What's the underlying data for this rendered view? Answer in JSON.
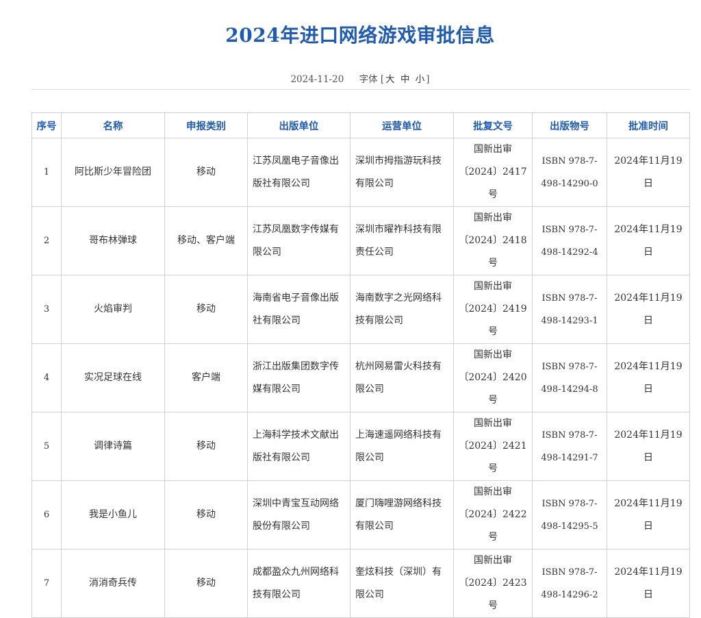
{
  "page": {
    "title": "2024年进口网络游戏审批信息",
    "date": "2024-11-20",
    "font_size_label": "字体",
    "font_size_open": "[",
    "font_size_large": "大",
    "font_size_medium": "中",
    "font_size_small": "小",
    "font_size_close": "]"
  },
  "table": {
    "headers": [
      "序号",
      "名称",
      "申报类别",
      "出版单位",
      "运营单位",
      "批复文号",
      "出版物号",
      "批准时间"
    ],
    "rows": [
      {
        "no": "1",
        "name": "阿比斯少年冒险团",
        "category": "移动",
        "publisher": "江苏凤凰电子音像出版社有限公司",
        "operator": "深圳市拇指游玩科技有限公司",
        "approval_no": "国新出审〔2024〕2417号",
        "isbn": "ISBN 978-7-498-14290-0",
        "date": "2024年11月19日"
      },
      {
        "no": "2",
        "name": "哥布林弹球",
        "category": "移动、客户端",
        "publisher": "江苏凤凰数字传媒有限公司",
        "operator": "深圳市曜祚科技有限责任公司",
        "approval_no": "国新出审〔2024〕2418号",
        "isbn": "ISBN 978-7-498-14292-4",
        "date": "2024年11月19日"
      },
      {
        "no": "3",
        "name": "火焰审判",
        "category": "移动",
        "publisher": "海南省电子音像出版社有限公司",
        "operator": "海南数字之光网络科技有限公司",
        "approval_no": "国新出审〔2024〕2419号",
        "isbn": "ISBN 978-7-498-14293-1",
        "date": "2024年11月19日"
      },
      {
        "no": "4",
        "name": "实况足球在线",
        "category": "客户端",
        "publisher": "浙江出版集团数字传媒有限公司",
        "operator": "杭州网易雷火科技有限公司",
        "approval_no": "国新出审〔2024〕2420号",
        "isbn": "ISBN 978-7-498-14294-8",
        "date": "2024年11月19日"
      },
      {
        "no": "5",
        "name": "调律诗篇",
        "category": "移动",
        "publisher": "上海科学技术文献出版社有限公司",
        "operator": "上海速遥网络科技有限公司",
        "approval_no": "国新出审〔2024〕2421号",
        "isbn": "ISBN 978-7-498-14291-7",
        "date": "2024年11月19日"
      },
      {
        "no": "6",
        "name": "我是小鱼儿",
        "category": "移动",
        "publisher": "深圳中青宝互动网络股份有限公司",
        "operator": "厦门嗨哩游网络科技有限公司",
        "approval_no": "国新出审〔2024〕2422号",
        "isbn": "ISBN 978-7-498-14295-5",
        "date": "2024年11月19日"
      },
      {
        "no": "7",
        "name": "消消奇兵传",
        "category": "移动",
        "publisher": "成都盈众九州网络科技有限公司",
        "operator": "奎炫科技（深圳）有限公司",
        "approval_no": "国新出审〔2024〕2423号",
        "isbn": "ISBN 978-7-498-14296-2",
        "date": "2024年11月19日"
      }
    ]
  }
}
